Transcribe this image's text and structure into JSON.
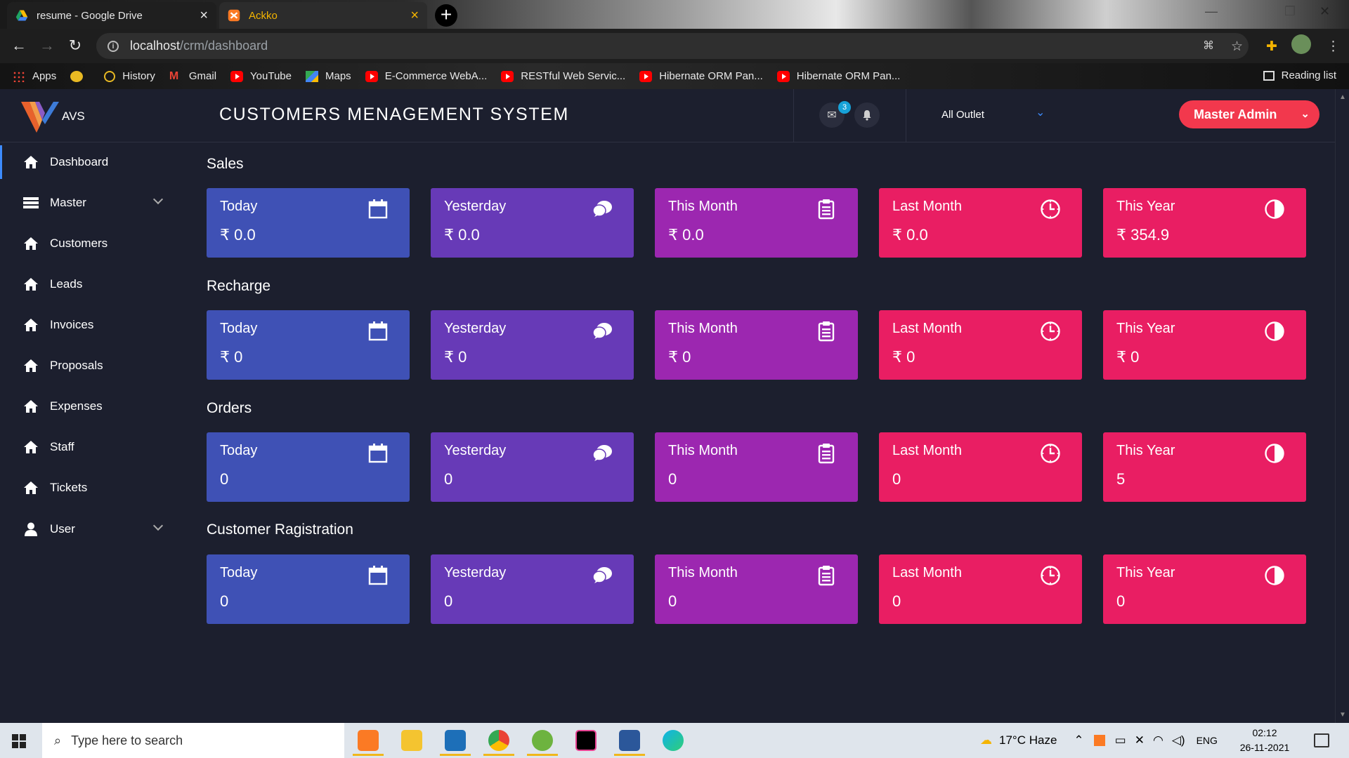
{
  "browser": {
    "tabs": [
      {
        "title": "resume - Google Drive",
        "active": false
      },
      {
        "title": "Ackko",
        "active": true
      }
    ],
    "url_host": "localhost",
    "url_path": "/crm/dashboard",
    "bookmarks": [
      {
        "label": "Apps",
        "icon": "apps-grid-icon"
      },
      {
        "label": "",
        "icon": "globe-icon"
      },
      {
        "label": "History",
        "icon": "history-icon"
      },
      {
        "label": "Gmail",
        "icon": "gmail-icon"
      },
      {
        "label": "YouTube",
        "icon": "youtube-icon"
      },
      {
        "label": "Maps",
        "icon": "maps-icon"
      },
      {
        "label": "E-Commerce WebA...",
        "icon": "youtube-icon"
      },
      {
        "label": "RESTful Web Servic...",
        "icon": "youtube-icon"
      },
      {
        "label": "Hibernate ORM Pan...",
        "icon": "youtube-icon"
      },
      {
        "label": "Hibernate ORM Pan...",
        "icon": "youtube-icon"
      }
    ],
    "reading_list": "Reading list"
  },
  "header": {
    "brand": "AVS",
    "title": "CUSTOMERS MENAGEMENT SYSTEM",
    "mail_count": "3",
    "outlet": "All Outlet",
    "admin": "Master Admin"
  },
  "sidebar": {
    "items": [
      {
        "label": "Dashboard",
        "icon": "home-icon",
        "active": true
      },
      {
        "label": "Master",
        "icon": "list-icon",
        "expandable": true
      },
      {
        "label": "Customers",
        "icon": "home-icon"
      },
      {
        "label": "Leads",
        "icon": "home-icon"
      },
      {
        "label": "Invoices",
        "icon": "home-icon"
      },
      {
        "label": "Proposals",
        "icon": "home-icon"
      },
      {
        "label": "Expenses",
        "icon": "home-icon"
      },
      {
        "label": "Staff",
        "icon": "home-icon"
      },
      {
        "label": "Tickets",
        "icon": "home-icon"
      },
      {
        "label": "User",
        "icon": "user-icon",
        "expandable": true
      }
    ]
  },
  "sections": [
    {
      "title": "Sales",
      "cards": [
        {
          "label": "Today",
          "value": "₹ 0.0",
          "icon": "calendar-icon",
          "color": "#3f51b5"
        },
        {
          "label": "Yesterday",
          "value": "₹ 0.0",
          "icon": "comments-icon",
          "color": "#673ab7"
        },
        {
          "label": "This Month",
          "value": "₹ 0.0",
          "icon": "clipboard-icon",
          "color": "#9c27b0"
        },
        {
          "label": "Last Month",
          "value": "₹ 0.0",
          "icon": "clock-icon",
          "color": "#e91e63"
        },
        {
          "label": "This Year",
          "value": "₹ 354.9",
          "icon": "half-circle-icon",
          "color": "#e91e63"
        }
      ]
    },
    {
      "title": "Recharge",
      "cards": [
        {
          "label": "Today",
          "value": "₹ 0",
          "icon": "calendar-icon",
          "color": "#3f51b5"
        },
        {
          "label": "Yesterday",
          "value": "₹ 0",
          "icon": "comments-icon",
          "color": "#673ab7"
        },
        {
          "label": "This Month",
          "value": "₹ 0",
          "icon": "clipboard-icon",
          "color": "#9c27b0"
        },
        {
          "label": "Last Month",
          "value": "₹ 0",
          "icon": "clock-icon",
          "color": "#e91e63"
        },
        {
          "label": "This Year",
          "value": "₹ 0",
          "icon": "half-circle-icon",
          "color": "#e91e63"
        }
      ]
    },
    {
      "title": "Orders",
      "cards": [
        {
          "label": "Today",
          "value": "0",
          "icon": "calendar-icon",
          "color": "#3f51b5"
        },
        {
          "label": "Yesterday",
          "value": "0",
          "icon": "comments-icon",
          "color": "#673ab7"
        },
        {
          "label": "This Month",
          "value": "0",
          "icon": "clipboard-icon",
          "color": "#9c27b0"
        },
        {
          "label": "Last Month",
          "value": "0",
          "icon": "clock-icon",
          "color": "#e91e63"
        },
        {
          "label": "This Year",
          "value": "5",
          "icon": "half-circle-icon",
          "color": "#e91e63"
        }
      ]
    },
    {
      "title": "Customer Ragistration",
      "cards": [
        {
          "label": "Today",
          "value": "0",
          "icon": "calendar-icon",
          "color": "#3f51b5"
        },
        {
          "label": "Yesterday",
          "value": "0",
          "icon": "comments-icon",
          "color": "#673ab7"
        },
        {
          "label": "This Month",
          "value": "0",
          "icon": "clipboard-icon",
          "color": "#9c27b0"
        },
        {
          "label": "Last Month",
          "value": "0",
          "icon": "clock-icon",
          "color": "#e91e63"
        },
        {
          "label": "This Year",
          "value": "0",
          "icon": "half-circle-icon",
          "color": "#e91e63"
        }
      ]
    }
  ],
  "taskbar": {
    "search_placeholder": "Type here to search",
    "weather": "17°C  Haze",
    "language": "ENG",
    "time": "02:12",
    "date": "26-11-2021"
  }
}
